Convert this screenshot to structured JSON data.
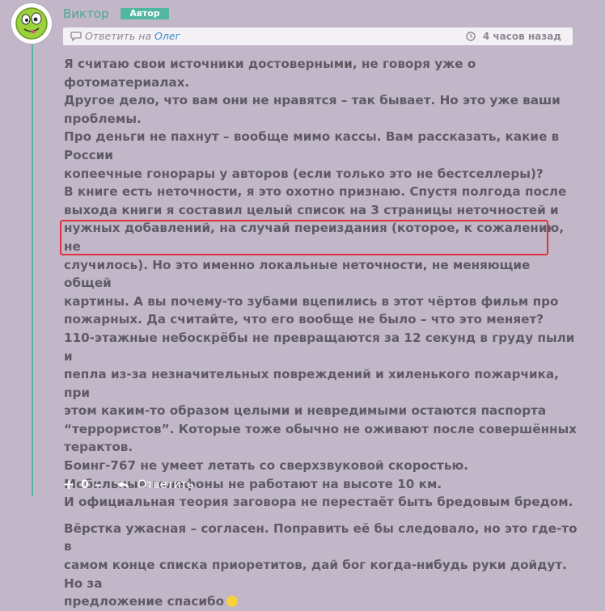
{
  "comment": {
    "author": "Виктор",
    "badge": "Автор",
    "reply_prefix": "Ответить на",
    "reply_target": "Олег",
    "timestamp": "4 часов назад",
    "paragraphs": [
      [
        "Я считаю свои источники достоверными, не говоря уже о фотоматериалах.",
        "Другое дело, что вам они не нравятся – так бывает. Но это уже ваши",
        "проблемы.",
        "Про деньги не пахнут – вообще мимо кассы. Вам рассказать, какие в России",
        "копеечные гонорары у авторов (если только это не бестселлеры)?",
        "В книге есть неточности, я это охотно признаю. Спустя полгода после",
        "выхода книги я составил целый список на 3 страницы неточностей и",
        "нужных добавлений, на случай переиздания (которое, к сожалению, не",
        "случилось). Но это именно локальные неточности, не меняющие общей",
        "картины. А вы почему-то зубами вцепились в этот чёртов фильм про",
        "пожарных. Да считайте, что его вообще не было – что это меняет?",
        "110-этажные небоскрёбы не превращаются за 12 секунд в груду пыли и",
        "пепла из-за незначительных повреждений и хиленького пожарчика, при",
        "этом каким-то образом целыми и невредимыми остаются паспорта",
        "“террористов”. Которые тоже обычно не оживают после совершённых",
        "терактов.",
        "Боинг-767 не умеет летать со сверхзвуковой скоростью.",
        "Мобильные телефоны не работают на высоте 10 км.",
        "И официальная теория заговора не перестаёт быть бредовым бредом."
      ],
      [
        "Вёрстка ужасная – согласен. Поправить её бы следовало, но это где-то в",
        "самом конце списка приоретитов, дай бог когда-нибудь руки дойдут. Но за",
        "предложение спасибо"
      ]
    ]
  },
  "footer": {
    "plus": "+",
    "count": "0",
    "minus": "–",
    "reply_label": "Ответить"
  },
  "icons": {
    "avatar": "smiley-face-icon",
    "reply_bubble": "speech-bubble-icon",
    "clock": "clock-icon",
    "reply_arrow": "reply-arrow-icon",
    "emoji": "smile-emoji-icon"
  },
  "colors": {
    "background": "#c2b7c9",
    "accent": "#52b79f",
    "link": "#3d8fc4",
    "highlight": "#e0323a"
  }
}
